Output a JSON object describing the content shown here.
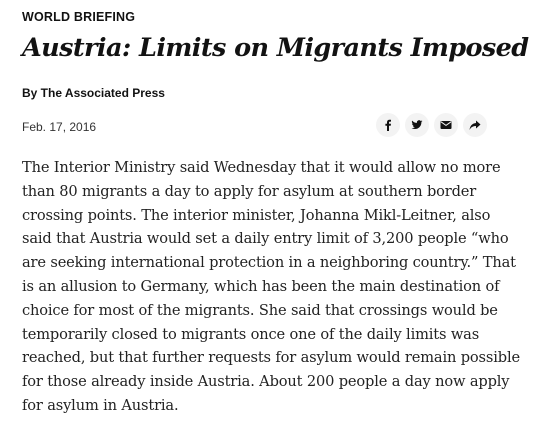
{
  "article": {
    "kicker": "WORLD BRIEFING",
    "headline": "Austria: Limits on Migrants Imposed",
    "byline": "By The Associated Press",
    "date": "Feb. 17, 2016",
    "body": "The Interior Ministry said Wednesday that it would allow no more than 80 migrants a day to apply for asylum at southern border crossing points. The interior minister, Johanna Mikl-Leitner, also said that Austria would set a daily entry limit of 3,200 people “who are seeking international protection in a neighboring country.” That is an allusion to Germany, which has been the main destination of choice for most of the migrants. She said that crossings would be temporarily closed to migrants once one of the daily limits was reached, but that further requests for asylum would remain possible for those already inside Austria. About 200 people a day now apply for asylum in Austria."
  },
  "share": {
    "buttons": [
      {
        "icon": "facebook-icon"
      },
      {
        "icon": "twitter-icon"
      },
      {
        "icon": "email-icon"
      },
      {
        "icon": "share-arrow-icon"
      }
    ],
    "button_background": "#f3f3f3",
    "icon_color": "#121212"
  },
  "colors": {
    "text": "#121212",
    "body_text": "#222222",
    "date": "#333333",
    "background": "#ffffff"
  }
}
